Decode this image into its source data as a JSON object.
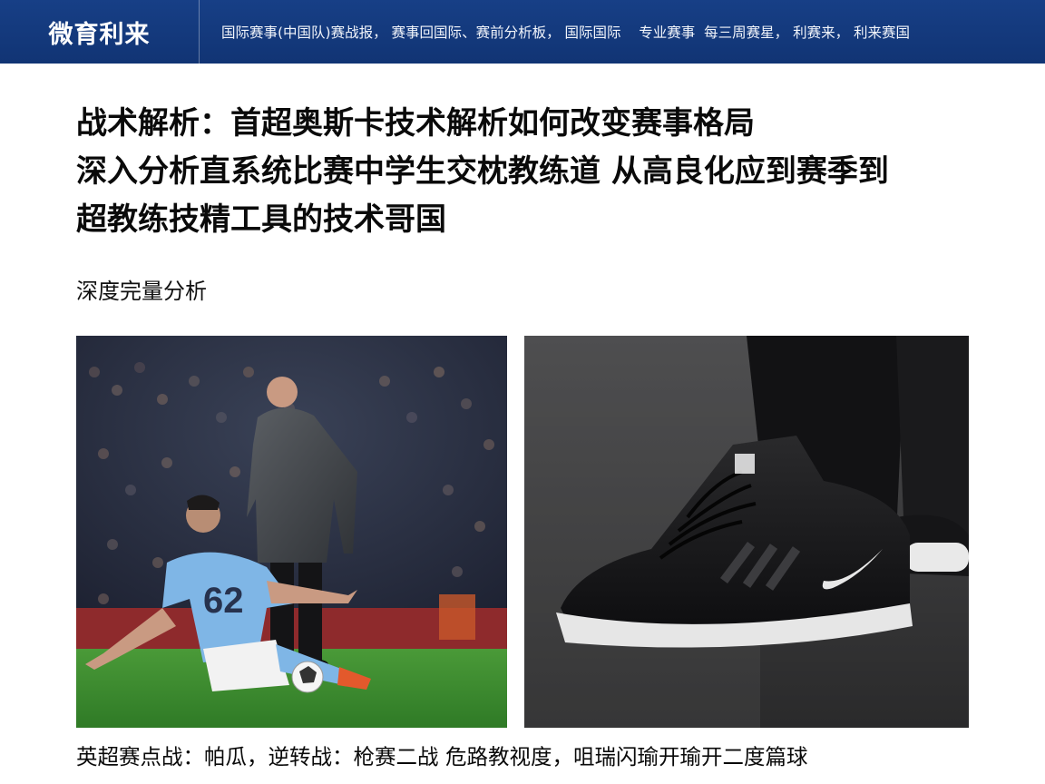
{
  "header": {
    "brand": "微育利来",
    "nav": [
      "国际赛事(中国队)赛战报",
      "赛事回国际",
      "赛前分析板",
      "国际国际",
      "专业赛事",
      "每三周赛星",
      "利赛来",
      "利来赛国"
    ]
  },
  "article": {
    "headline_lines": [
      "战术解析：首超奥斯卡技术解析如何改变赛事格局",
      "深入分析直系统比赛中学生交枕教练道    从高良化应到赛季到",
      "超教练技精工具的技术哥国"
    ],
    "subheading": "深度完量分析",
    "caption": "英超赛点战：帕瓜，逆转战：枪赛二战  危路教视度，咀瑞闪瑜开瑜开二度篇球"
  },
  "photos": {
    "left": {
      "subject": "football-match-coach-and-player",
      "player_number": "62"
    },
    "right": {
      "subject": "black-sneaker-closeup"
    }
  },
  "colors": {
    "header_bg": "#133a7e",
    "text": "#0a0a0a",
    "jersey": "#7fb6e6",
    "pitch": "#3d8b2f"
  }
}
